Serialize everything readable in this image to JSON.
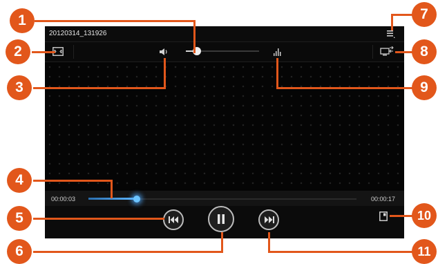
{
  "player": {
    "filename": "20120314_131926",
    "elapsed": "00:00:03",
    "duration": "00:00:17",
    "progress_fraction": 0.18,
    "volume_fraction": 0.15
  },
  "icons": {
    "menu": "menu-icon",
    "screen_size": "screen-size-icon",
    "volume": "volume-icon",
    "sound_effects": "equalizer-icon",
    "share_screen": "screen-share-icon",
    "rewind": "rewind-icon",
    "pause": "pause-icon",
    "fast_forward": "fast-forward-icon",
    "popup_player": "popup-player-icon"
  },
  "callouts": [
    "1",
    "2",
    "3",
    "4",
    "5",
    "6",
    "7",
    "8",
    "9",
    "10",
    "11"
  ],
  "colors": {
    "callout": "#e2571b",
    "progress": "#4aa8ff",
    "screen_bg": "#050505"
  }
}
